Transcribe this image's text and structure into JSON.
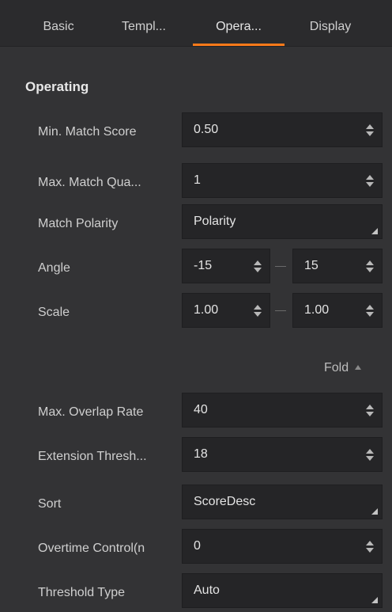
{
  "tabs": [
    {
      "label": "Basic"
    },
    {
      "label": "Templ..."
    },
    {
      "label": "Opera..."
    },
    {
      "label": "Display"
    }
  ],
  "section": {
    "title": "Operating"
  },
  "rows": {
    "min_match_score": {
      "label": "Min. Match Score",
      "value": "0.50"
    },
    "max_match_quantity": {
      "label": "Max. Match Qua...",
      "value": "1"
    },
    "match_polarity": {
      "label": "Match Polarity",
      "value": "Polarity"
    },
    "angle": {
      "label": "Angle",
      "from": "-15",
      "to": "15"
    },
    "scale": {
      "label": "Scale",
      "from": "1.00",
      "to": "1.00"
    },
    "max_overlap_rate": {
      "label": "Max. Overlap Rate",
      "value": "40"
    },
    "extension_threshold": {
      "label": "Extension Thresh...",
      "value": "18"
    },
    "sort": {
      "label": "Sort",
      "value": "ScoreDesc"
    },
    "overtime_control": {
      "label": "Overtime Control(n",
      "value": "0"
    },
    "threshold_type": {
      "label": "Threshold Type",
      "value": "Auto"
    }
  },
  "fold": {
    "label": "Fold"
  },
  "colors": {
    "accent": "#ff7a1a",
    "background": "#333335",
    "field": "#252527"
  }
}
